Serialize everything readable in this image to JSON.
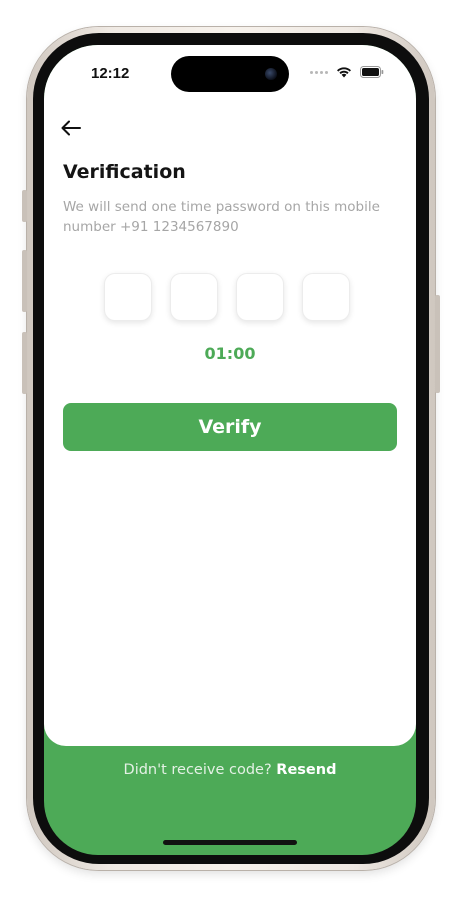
{
  "status_bar": {
    "time": "12:12",
    "icons": [
      "signal-dots-icon",
      "wifi-icon",
      "battery-icon"
    ]
  },
  "header": {
    "back_icon": "arrow-left-icon"
  },
  "verification": {
    "title": "Verification",
    "subtitle": "We will send one time password on this mobile number +91 1234567890",
    "otp_digits": [
      "",
      "",
      "",
      ""
    ],
    "timer": "01:00",
    "verify_label": "Verify"
  },
  "footer": {
    "question": "Didn't receive code?",
    "resend_label": "Resend"
  },
  "colors": {
    "accent": "#4daa57",
    "title": "#141414",
    "subtitle": "#a6a6a6"
  }
}
